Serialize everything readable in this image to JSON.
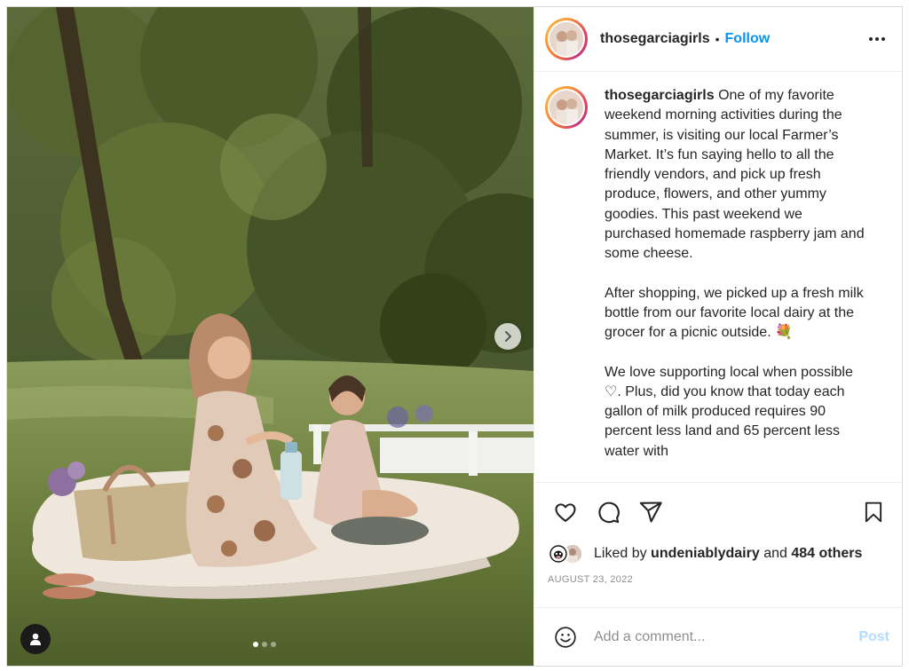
{
  "header": {
    "username": "thosegarciagirls",
    "separator": "•",
    "follow_label": "Follow",
    "more_icon": "more-horizontal-icon"
  },
  "caption": {
    "username": "thosegarciagirls",
    "paragraphs": [
      "One of my favorite weekend morning activities during the summer, is visiting our local Farmer’s Market. It’s fun saying hello to all the friendly vendors, and pick up fresh produce, flowers, and other yummy goodies. This past weekend we purchased homemade raspberry jam and some cheese.",
      "After shopping, we picked up a fresh milk bottle from our favorite local dairy at the grocer for a picnic outside. 💐",
      "We love supporting local when possible ♡. Plus, did you know that today each gallon of milk produced requires 90 percent less land and 65 percent less water with"
    ]
  },
  "actions": {
    "like_icon": "heart-icon",
    "comment_icon": "comment-icon",
    "share_icon": "share-icon",
    "save_icon": "bookmark-icon"
  },
  "likes": {
    "prefix": "Liked by ",
    "user": "undeniablydairy",
    "middle": " and ",
    "others": "484 others"
  },
  "date": "AUGUST 23, 2022",
  "comment": {
    "placeholder": "Add a comment...",
    "post_label": "Post",
    "emoji_icon": "emoji-icon"
  },
  "carousel": {
    "total": 3,
    "current": 1
  },
  "colors": {
    "accent": "#0095f6",
    "post_disabled": "#b3dbff",
    "muted": "#8e8e8e"
  }
}
